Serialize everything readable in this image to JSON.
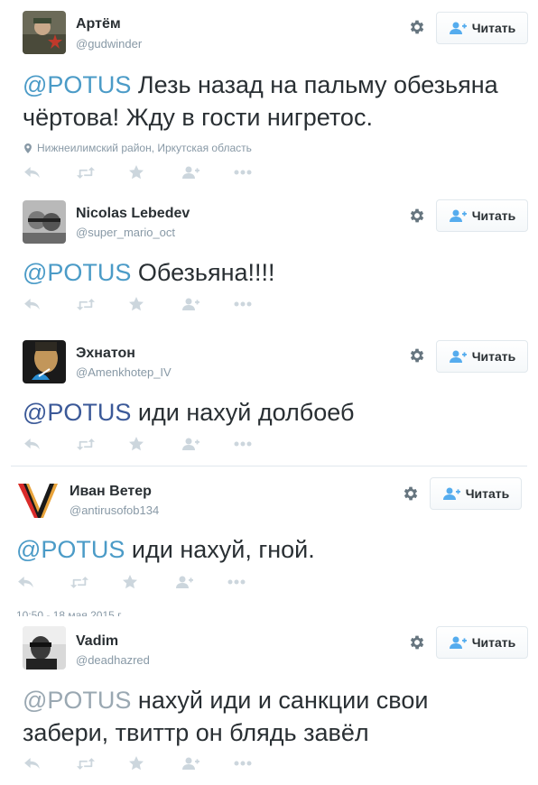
{
  "follow_label": "Читать",
  "colors": {
    "mention": "#4b9bc7",
    "text": "#292f33",
    "muted": "#8899a6",
    "icon": "#ccd6dd"
  },
  "tweets": [
    {
      "name": "Артём",
      "handle": "@gudwinder",
      "mention": "@POTUS",
      "text_line1": " Лезь назад на пальму обезьяна",
      "text_line2": "чёртова! Жду в гости нигретос.",
      "location": "Нижнеилимский район, Иркутская область"
    },
    {
      "name": "Nicolas Lebedev",
      "handle": "@super_mario_oct",
      "mention": "@POTUS",
      "text_line1": " Обезьяна!!!!"
    },
    {
      "name": "Эхнатон",
      "handle": "@Amenkhotep_IV",
      "mention": "@POTUS",
      "text_line1": " иди нахуй долбоеб"
    },
    {
      "name": "Иван Ветер",
      "handle": "@antirusofob134",
      "mention": "@POTUS",
      "text_line1": " иди нахуй, гной."
    },
    {
      "name": "Vadim",
      "handle": "@deadhazred",
      "mention": "@POTUS",
      "text_line1": " нахуй иди и санкции свои",
      "text_line2": "забери, твиттр он блядь завёл"
    }
  ],
  "timestamp": "10:50 - 18 мая 2015 г.",
  "icons": [
    "reply-icon",
    "retweet-icon",
    "favorite-icon",
    "follow-icon",
    "more-icon",
    "gear-icon",
    "location-pin-icon"
  ]
}
